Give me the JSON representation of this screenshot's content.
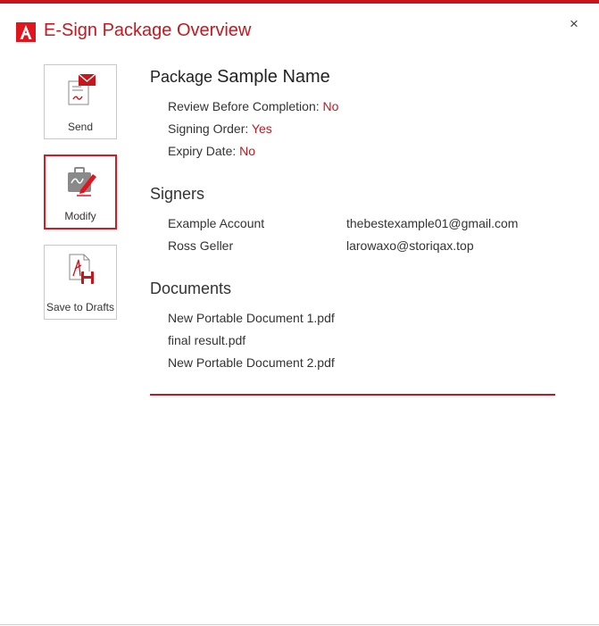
{
  "window": {
    "title": "E-Sign Package Overview",
    "close_glyph": "×",
    "logo_icon": "acrobat-logo-icon",
    "accent_color": "#c8161d"
  },
  "actions": [
    {
      "label": "Send",
      "icon": "send-envelope-icon"
    },
    {
      "label": "Modify",
      "icon": "modify-signature-icon",
      "selected": true
    },
    {
      "label": "Save to Drafts",
      "icon": "save-drafts-icon"
    }
  ],
  "package": {
    "prefix": "Package",
    "name": "Sample Name",
    "fields": [
      {
        "label": "Review Before Completion:",
        "value": "No"
      },
      {
        "label": "Signing Order:",
        "value": "Yes"
      },
      {
        "label": "Expiry Date:",
        "value": "No"
      }
    ]
  },
  "signers": {
    "heading": "Signers",
    "items": [
      {
        "name": "Example Account",
        "email": "thebestexample01@gmail.com"
      },
      {
        "name": "Ross Geller",
        "email": "larowaxo@storiqax.top"
      }
    ]
  },
  "documents": {
    "heading": "Documents",
    "items": [
      "New Portable Document 1.pdf",
      "final result.pdf",
      "New Portable Document 2.pdf"
    ]
  }
}
